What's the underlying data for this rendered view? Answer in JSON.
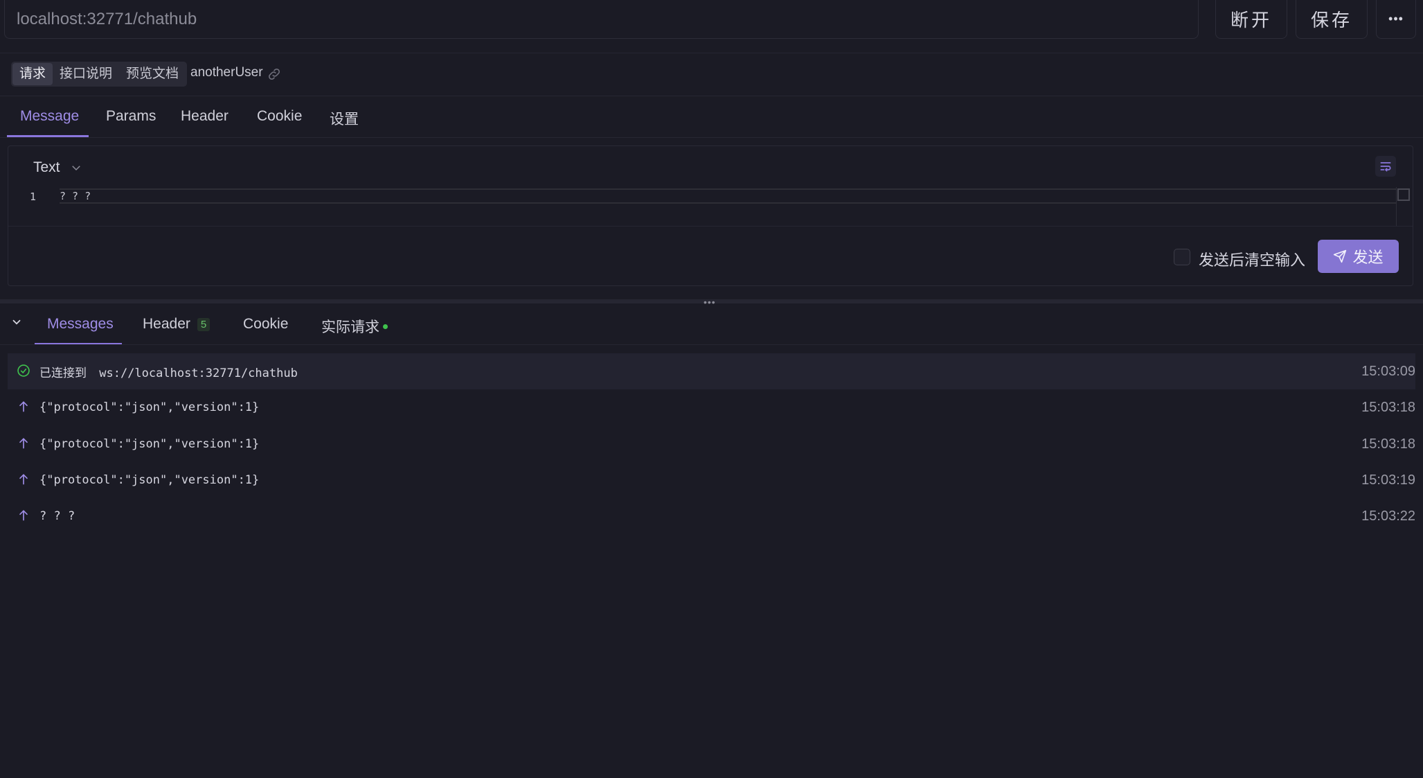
{
  "url_bar": {
    "value": "localhost:32771/chathub"
  },
  "toolbar": {
    "disconnect_label": "断开",
    "save_label": "保存",
    "more_label": "•••"
  },
  "mode_tabs": [
    {
      "label": "请求",
      "active": true
    },
    {
      "label": "接口说明",
      "active": false
    },
    {
      "label": "预览文档",
      "active": false
    }
  ],
  "user_name": "anotherUser",
  "request_tabs": [
    {
      "label": "Message",
      "active": true
    },
    {
      "label": "Params",
      "active": false
    },
    {
      "label": "Header",
      "active": false
    },
    {
      "label": "Cookie",
      "active": false
    },
    {
      "label": "设置",
      "active": false
    }
  ],
  "editor": {
    "type_label": "Text",
    "lines": [
      {
        "number": "1",
        "text": "? ? ?"
      }
    ]
  },
  "send_panel": {
    "clear_after_send_label": "发送后清空输入",
    "clear_after_send_checked": false,
    "send_label": "发送"
  },
  "resizer": {
    "dots": "•••"
  },
  "response_tabs": [
    {
      "label": "Messages",
      "active": true
    },
    {
      "label": "Header",
      "badge": "5",
      "active": false
    },
    {
      "label": "Cookie",
      "active": false
    },
    {
      "label": "实际请求",
      "status_dot": true,
      "active": false
    }
  ],
  "messages": [
    {
      "icon": "check-circle-icon",
      "prefix": "已连接到",
      "text": "ws://localhost:32771/chathub",
      "time": "15:03:09"
    },
    {
      "icon": "arrow-up-icon",
      "text": "{\"protocol\":\"json\",\"version\":1}",
      "time": "15:03:18"
    },
    {
      "icon": "arrow-up-icon",
      "text": "{\"protocol\":\"json\",\"version\":1}",
      "time": "15:03:18"
    },
    {
      "icon": "arrow-up-icon",
      "text": "{\"protocol\":\"json\",\"version\":1}",
      "time": "15:03:19"
    },
    {
      "icon": "arrow-up-icon",
      "text": "? ? ?",
      "time": "15:03:22"
    }
  ],
  "colors": {
    "background": "#1b1b25",
    "accent": "#8a76dd",
    "send_button": "#8575d2",
    "success": "#3fc24d"
  }
}
